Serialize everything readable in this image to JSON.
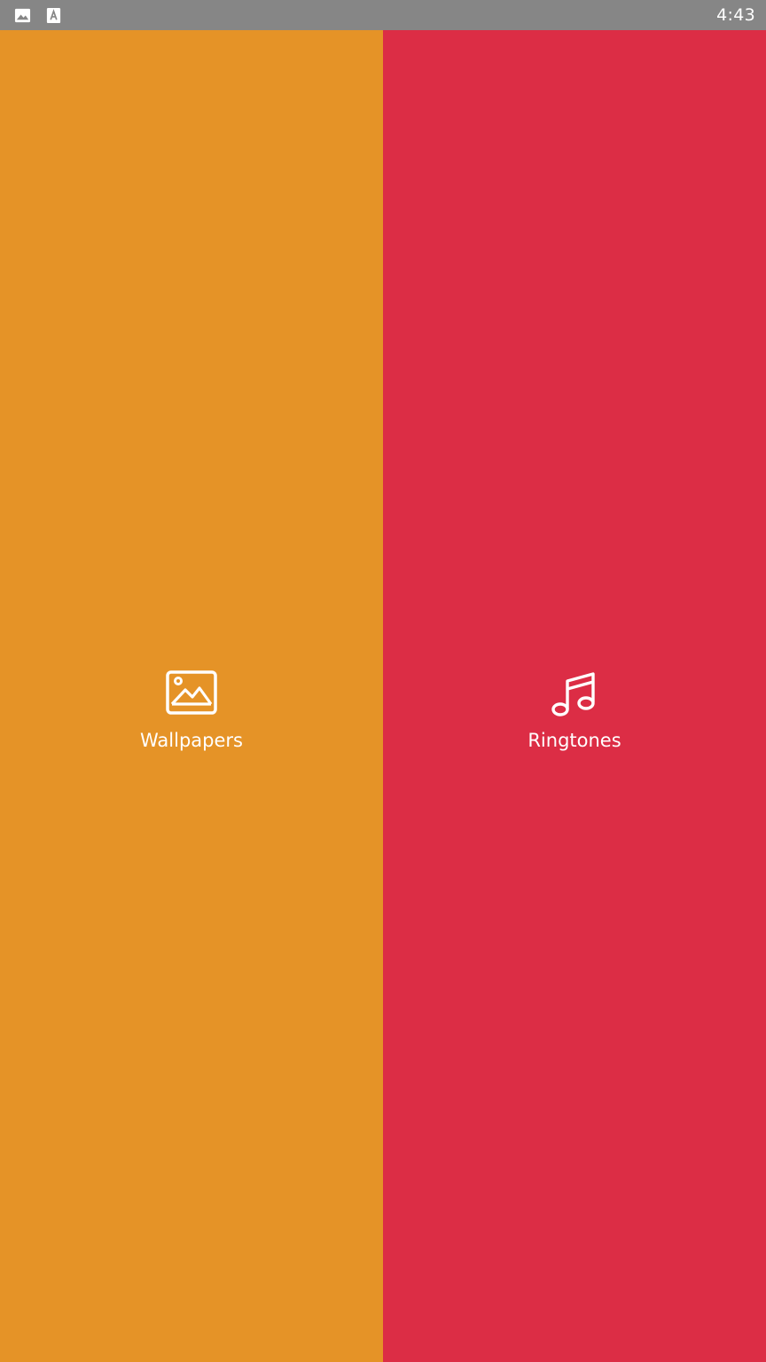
{
  "status_bar": {
    "time": "4:43",
    "background": "#868686",
    "left_icons": [
      "image-notification-icon",
      "text-notification-icon"
    ]
  },
  "panels": [
    {
      "label": "Wallpapers",
      "icon": "image-icon",
      "color": "#E59327"
    },
    {
      "label": "Ringtones",
      "icon": "music-note-icon",
      "color": "#DC2D45"
    }
  ]
}
